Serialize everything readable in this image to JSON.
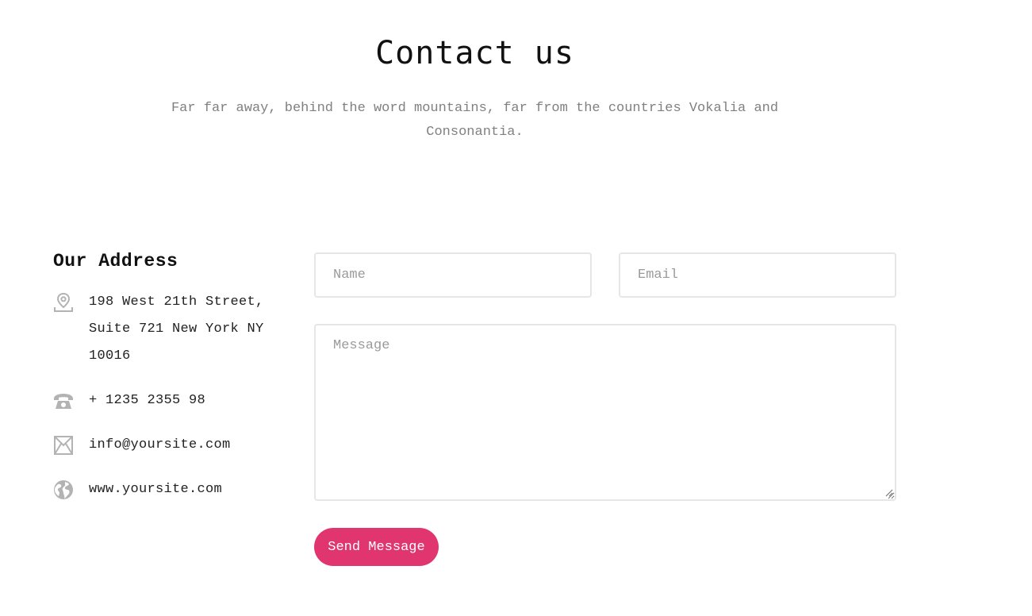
{
  "header": {
    "title": "Contact us",
    "subtitle": "Far far away, behind the word mountains, far from the countries Vokalia and Consonantia."
  },
  "address_block": {
    "title": "Our Address",
    "address": "198 West 21th Street, Suite 721 New York NY 10016",
    "phone": "+ 1235 2355 98",
    "email": "info@yoursite.com",
    "website": "www.yoursite.com",
    "icons": {
      "address": "map-pin-icon",
      "phone": "phone-icon",
      "email": "envelope-icon",
      "website": "globe-icon"
    }
  },
  "form": {
    "name_placeholder": "Name",
    "email_placeholder": "Email",
    "message_placeholder": "Message",
    "name_value": "",
    "email_value": "",
    "message_value": "",
    "submit_label": "Send Message"
  },
  "colors": {
    "accent": "#e0356e",
    "icon_gray": "#b3b3b3",
    "subtitle_gray": "#808080",
    "border": "#e6e6e6"
  }
}
